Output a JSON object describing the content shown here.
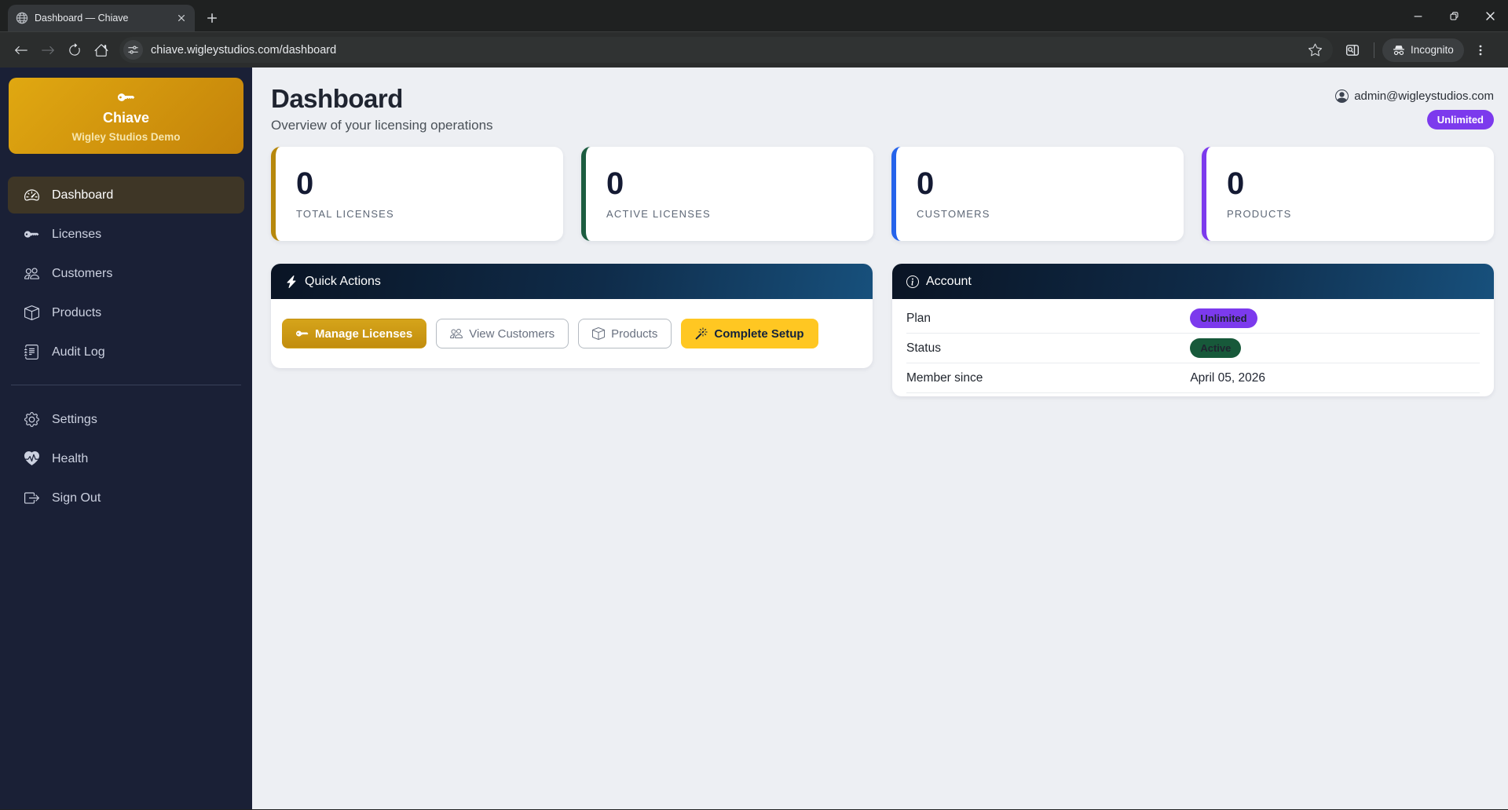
{
  "browser": {
    "tab_title": "Dashboard — Chiave",
    "url": "chiave.wigleystudios.com/dashboard",
    "incognito_label": "Incognito"
  },
  "sidebar": {
    "brand": {
      "icon": "key",
      "name": "Chiave",
      "subtitle": "Wigley Studios Demo"
    },
    "items": [
      {
        "label": "Dashboard",
        "icon": "speedometer",
        "active": true
      },
      {
        "label": "Licenses",
        "icon": "key",
        "active": false
      },
      {
        "label": "Customers",
        "icon": "people",
        "active": false
      },
      {
        "label": "Products",
        "icon": "box",
        "active": false
      },
      {
        "label": "Audit Log",
        "icon": "journal",
        "active": false
      }
    ],
    "footer_items": [
      {
        "label": "Settings",
        "icon": "gear",
        "active": false
      },
      {
        "label": "Health",
        "icon": "heart-pulse",
        "active": false
      },
      {
        "label": "Sign Out",
        "icon": "sign-out",
        "active": false
      }
    ]
  },
  "header": {
    "title": "Dashboard",
    "subtitle": "Overview of your licensing operations",
    "user_email": "admin@wigleystudios.com",
    "plan_badge": "Unlimited"
  },
  "stats": [
    {
      "value": "0",
      "label": "TOTAL LICENSES",
      "accent": "#b7880c"
    },
    {
      "value": "0",
      "label": "ACTIVE LICENSES",
      "accent": "#1c5c40"
    },
    {
      "value": "0",
      "label": "CUSTOMERS",
      "accent": "#2563eb"
    },
    {
      "value": "0",
      "label": "PRODUCTS",
      "accent": "#7c3aed"
    }
  ],
  "quick_actions": {
    "title": "Quick Actions",
    "icon": "bolt",
    "buttons": [
      {
        "label": "Manage Licenses",
        "icon": "key",
        "style": "gold"
      },
      {
        "label": "View Customers",
        "icon": "people",
        "style": "outline"
      },
      {
        "label": "Products",
        "icon": "box",
        "style": "outline"
      },
      {
        "label": "Complete Setup",
        "icon": "magic",
        "style": "yellow"
      }
    ]
  },
  "account": {
    "title": "Account",
    "icon": "info",
    "rows": [
      {
        "label": "Plan",
        "value": "Unlimited",
        "badge": "purple"
      },
      {
        "label": "Status",
        "value": "Active",
        "badge": "green"
      },
      {
        "label": "Member since",
        "value": "April 05, 2026",
        "badge": null
      }
    ]
  },
  "colors": {
    "brand_gold": "#d29a10",
    "accent_yellow": "#ffc722",
    "badge_purple": "#7c3aed",
    "badge_green": "#17593a",
    "sidebar_navy": "#1a2036",
    "panel_header_navy": "#0f2c4a"
  }
}
